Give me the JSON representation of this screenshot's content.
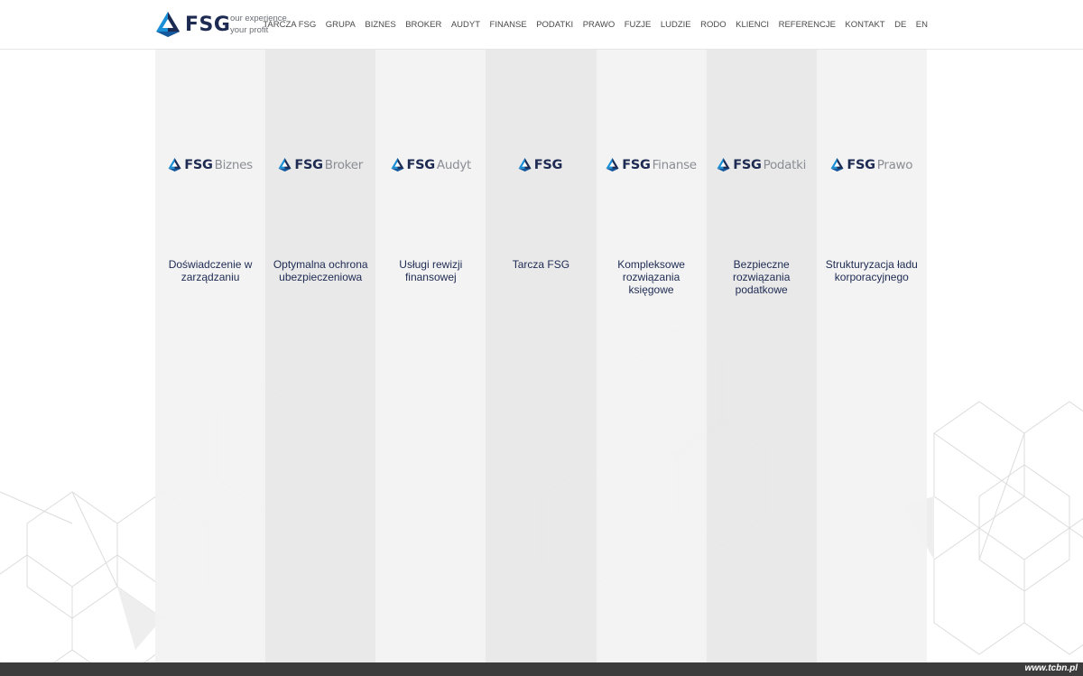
{
  "header": {
    "logo_text": "FSG",
    "tagline_line1": "our experience",
    "tagline_line2": "your profit",
    "nav": [
      "TARCZA FSG",
      "GRUPA",
      "BIZNES",
      "BROKER",
      "AUDYT",
      "FINANSE",
      "PODATKI",
      "PRAWO",
      "FUZJE",
      "LUDZIE",
      "RODO",
      "KLIENCI",
      "REFERENCJE",
      "KONTAKT",
      "DE",
      "EN"
    ]
  },
  "columns": [
    {
      "brand_main": "FSG",
      "brand_sub": "Biznes",
      "text": "Doświadczenie w zarządzaniu"
    },
    {
      "brand_main": "FSG",
      "brand_sub": "Broker",
      "text": "Optymalna ochrona ubezpieczeniowa"
    },
    {
      "brand_main": "FSG",
      "brand_sub": "Audyt",
      "text": "Usługi rewizji finansowej"
    },
    {
      "brand_main": "FSG",
      "brand_sub": "",
      "text": "Tarcza FSG"
    },
    {
      "brand_main": "FSG",
      "brand_sub": "Finanse",
      "text": "Kompleksowe rozwiązania księgowe"
    },
    {
      "brand_main": "FSG",
      "brand_sub": "Podatki",
      "text": "Bezpieczne rozwiązania podatkowe"
    },
    {
      "brand_main": "FSG",
      "brand_sub": "Prawo",
      "text": "Strukturyzacja ładu korporacyjnego"
    }
  ],
  "footer": {
    "watermark": "www.tcbn.pl"
  },
  "colors": {
    "navy": "#1d2a52",
    "blue": "#1a8fd6",
    "bar": "#3c3c3c"
  }
}
